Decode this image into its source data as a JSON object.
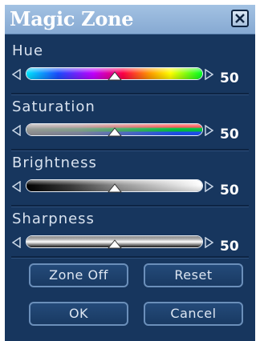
{
  "window": {
    "title": "Magic Zone",
    "close_icon": "close-icon"
  },
  "sliders": [
    {
      "label": "Hue",
      "value": "50",
      "position_percent": 50
    },
    {
      "label": "Saturation",
      "value": "50",
      "position_percent": 50
    },
    {
      "label": "Brightness",
      "value": "50",
      "position_percent": 50
    },
    {
      "label": "Sharpness",
      "value": "50",
      "position_percent": 50
    }
  ],
  "buttons": {
    "zone_off": "Zone Off",
    "reset": "Reset",
    "ok": "OK",
    "cancel": "Cancel"
  },
  "colors": {
    "panel_bg": "#17365e",
    "titlebar": "#8fb0d8",
    "hue_gradient": [
      "#00e5ff",
      "#1a4cff",
      "#c000ff",
      "#ff0044",
      "#ff9900",
      "#ffff00",
      "#00ff22"
    ],
    "saturation_gradient": [
      "#9a9a9a",
      "#ff2a2a",
      "#00c040",
      "#2255ff"
    ],
    "brightness_gradient": [
      "#000000",
      "#ffffff"
    ],
    "sharpness_gradient": [
      "#222222",
      "#f0f0f0",
      "#222222"
    ]
  }
}
